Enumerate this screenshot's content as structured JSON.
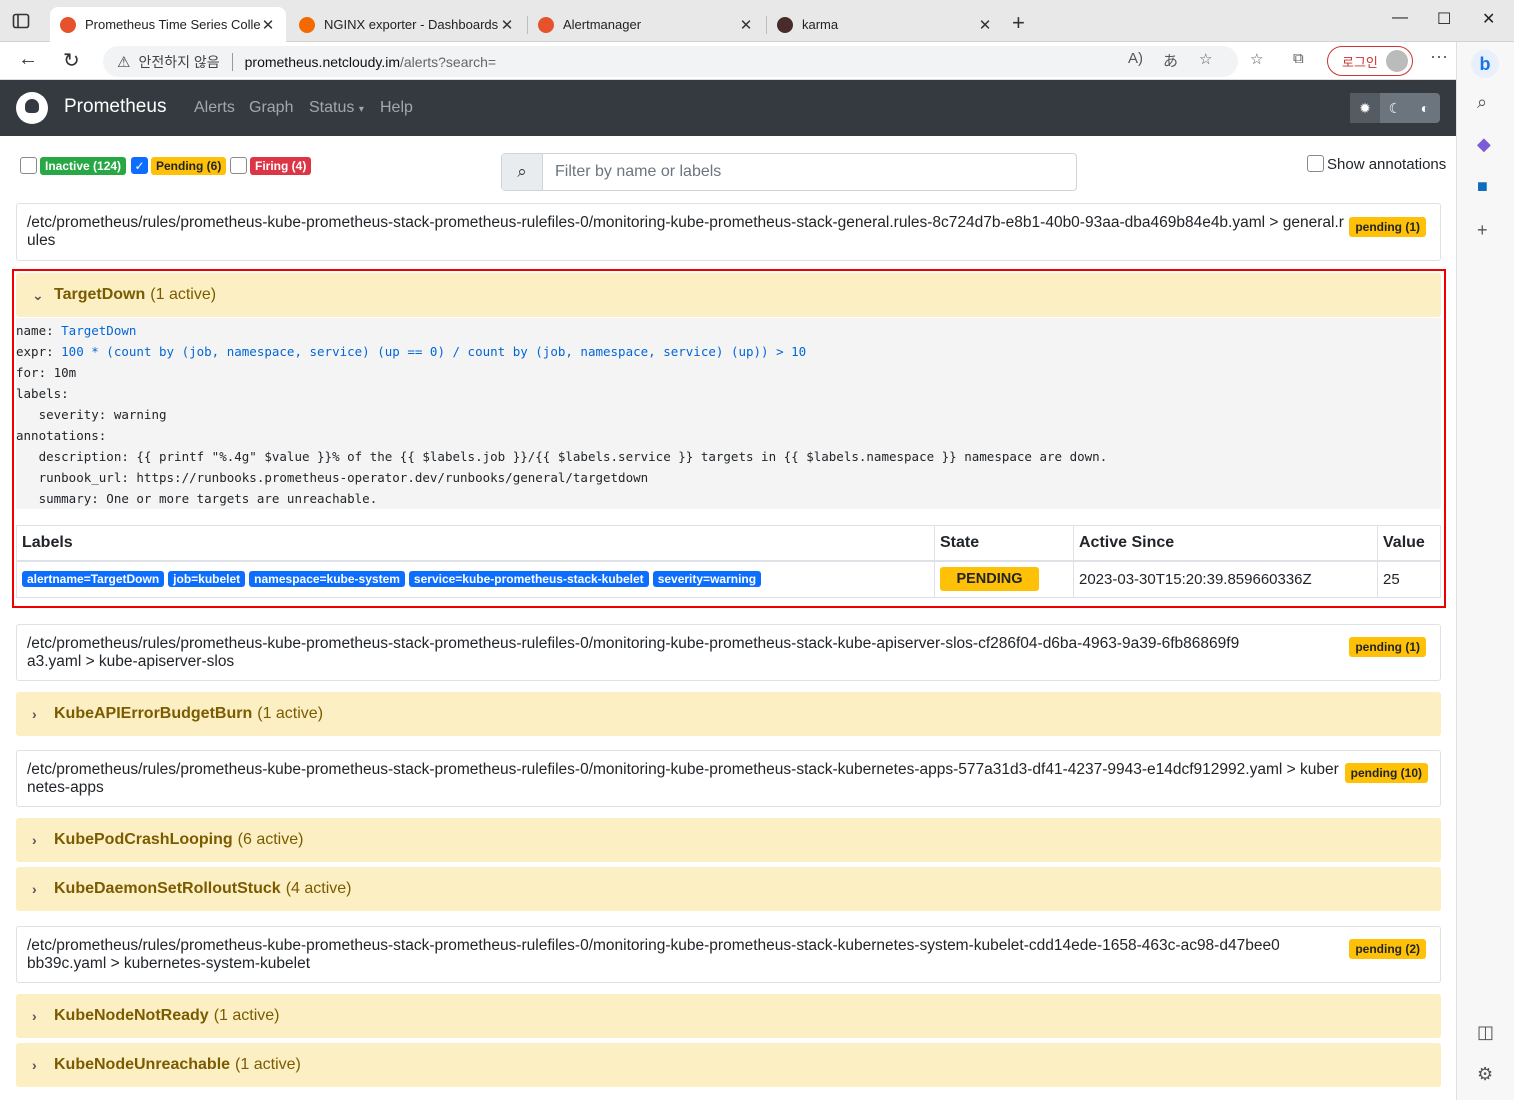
{
  "browser": {
    "tabs": [
      {
        "title": "Prometheus Time Series Collectio",
        "active": true
      },
      {
        "title": "NGINX exporter - Dashboards - G",
        "active": false
      },
      {
        "title": "Alertmanager",
        "active": false
      },
      {
        "title": "karma",
        "active": false
      }
    ],
    "security_label": "안전하지 않음",
    "url_host": "prometheus.netcloudy.im",
    "url_path": "/alerts?search=",
    "login_label": "로그인"
  },
  "navbar": {
    "brand": "Prometheus",
    "links": [
      "Alerts",
      "Graph",
      "Status",
      "Help"
    ]
  },
  "filters": {
    "inactive": {
      "label": "Inactive (124)",
      "checked": false
    },
    "pending": {
      "label": "Pending (6)",
      "checked": true
    },
    "firing": {
      "label": "Firing (4)",
      "checked": false
    },
    "search_placeholder": "Filter by name or labels",
    "show_annotations": "Show annotations"
  },
  "groups": [
    {
      "path": "/etc/prometheus/rules/prometheus-kube-prometheus-stack-prometheus-rulefiles-0/monitoring-kube-prometheus-stack-general.rules-8c724d7b-e8b1-40b0-93aa-dba469b84e4b.yaml > general.rules",
      "badge": "pending (1)"
    },
    {
      "path": "/etc/prometheus/rules/prometheus-kube-prometheus-stack-prometheus-rulefiles-0/monitoring-kube-prometheus-stack-kube-apiserver-slos-cf286f04-d6ba-4963-9a39-6fb86869f9a3.yaml > kube-apiserver-slos",
      "badge": "pending (1)"
    },
    {
      "path": "/etc/prometheus/rules/prometheus-kube-prometheus-stack-prometheus-rulefiles-0/monitoring-kube-prometheus-stack-kubernetes-apps-577a31d3-df41-4237-9943-e14dcf912992.yaml > kubernetes-apps",
      "badge": "pending (10)"
    },
    {
      "path": "/etc/prometheus/rules/prometheus-kube-prometheus-stack-prometheus-rulefiles-0/monitoring-kube-prometheus-stack-kubernetes-system-kubelet-cdd14ede-1658-463c-ac98-d47bee0bb39c.yaml > kubernetes-system-kubelet",
      "badge": "pending (2)"
    }
  ],
  "rules": [
    {
      "name": "TargetDown",
      "active": "(1 active)"
    },
    {
      "name": "KubeAPIErrorBudgetBurn",
      "active": "(1 active)"
    },
    {
      "name": "KubePodCrashLooping",
      "active": "(6 active)"
    },
    {
      "name": "KubeDaemonSetRolloutStuck",
      "active": "(4 active)"
    },
    {
      "name": "KubeNodeNotReady",
      "active": "(1 active)"
    },
    {
      "name": "KubeNodeUnreachable",
      "active": "(1 active)"
    }
  ],
  "rule_detail": {
    "name_key": "name: ",
    "name_val": "TargetDown",
    "expr_key": "expr: ",
    "expr_val": "100 * (count by (job, namespace, service) (up == 0) / count by (job, namespace, service) (up)) > 10",
    "for_line": "for: 10m",
    "labels_line": "labels:",
    "severity_line": "   severity: warning",
    "annotations_line": "annotations:",
    "description_line": "   description: {{ printf \"%.4g\" $value }}% of the {{ $labels.job }}/{{ $labels.service }} targets in {{ $labels.namespace }} namespace are down.",
    "runbook_line": "   runbook_url: https://runbooks.prometheus-operator.dev/runbooks/general/targetdown",
    "summary_line": "   summary: One or more targets are unreachable."
  },
  "alert_table": {
    "headers": [
      "Labels",
      "State",
      "Active Since",
      "Value"
    ],
    "labels": [
      "alertname=TargetDown",
      "job=kubelet",
      "namespace=kube-system",
      "service=kube-prometheus-stack-kubelet",
      "severity=warning"
    ],
    "state": "PENDING",
    "active_since": "2023-03-30T15:20:39.859660336Z",
    "value": "25"
  }
}
